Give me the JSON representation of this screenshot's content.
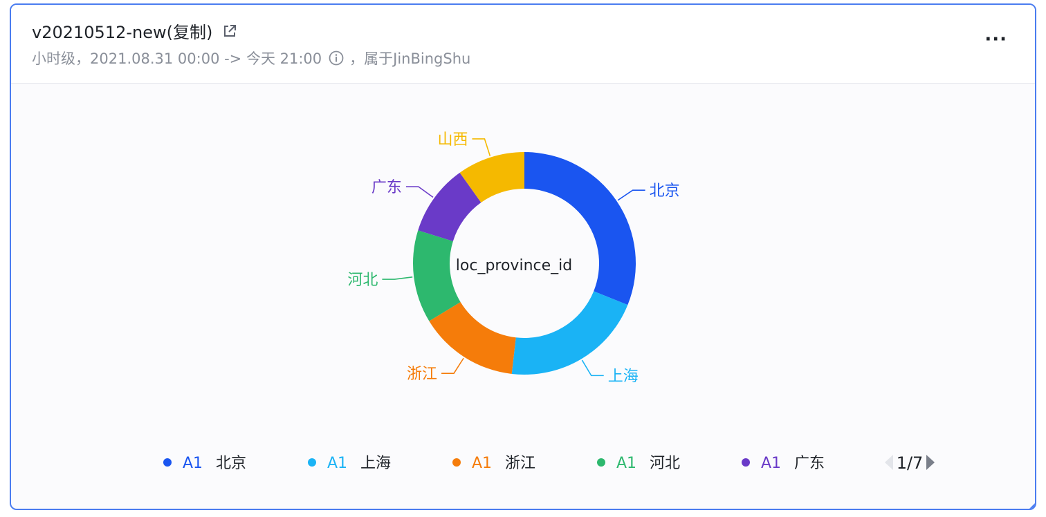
{
  "card": {
    "title": "v20210512-new(复制)",
    "subtitle_prefix": "小时级，2021.08.31 00:00 -> 今天 21:00",
    "subtitle_suffix": "，属于JinBingShu",
    "more_label": "···"
  },
  "chart_data": {
    "type": "pie",
    "donut": true,
    "center_label": "loc_province_id",
    "slices": [
      {
        "label": "北京",
        "value": 30,
        "color": "#1a55f0"
      },
      {
        "label": "上海",
        "value": 20,
        "color": "#1ab3f5"
      },
      {
        "label": "浙江",
        "value": 14,
        "color": "#f57c0a"
      },
      {
        "label": "河北",
        "value": 13,
        "color": "#2db86e"
      },
      {
        "label": "广东",
        "value": 10,
        "color": "#6a3ac8"
      },
      {
        "label": "山西",
        "value": 9.5,
        "color": "#f5b900"
      }
    ],
    "legend": {
      "placement": "bottom",
      "items": [
        {
          "series": "A1",
          "label": "北京",
          "color": "#1a55f0"
        },
        {
          "series": "A1",
          "label": "上海",
          "color": "#1ab3f5"
        },
        {
          "series": "A1",
          "label": "浙江",
          "color": "#f57c0a"
        },
        {
          "series": "A1",
          "label": "河北",
          "color": "#2db86e"
        },
        {
          "series": "A1",
          "label": "广东",
          "color": "#6a3ac8"
        }
      ],
      "page": "1/7"
    }
  }
}
